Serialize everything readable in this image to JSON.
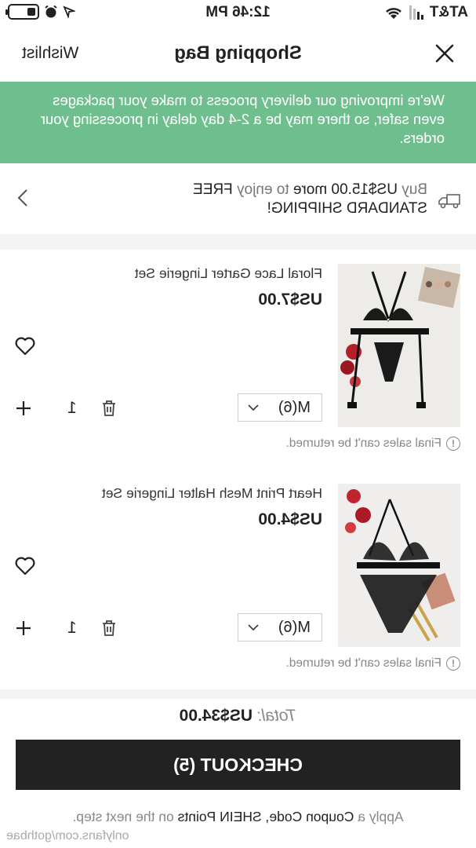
{
  "status_bar": {
    "time": "12:46 PM",
    "carrier": "AT&T"
  },
  "header": {
    "title": "Shopping Bag",
    "wishlist_label": "Wishlist"
  },
  "banner": {
    "text": "We're improving our delivery process to make your packages even safer, so there may be a 2-4 day delay in processing your orders."
  },
  "shipping": {
    "prefix": "Buy",
    "amount": "US$15.00 more",
    "middle": "to enjoy",
    "suffix": "FREE STANDARD SHIPPING!"
  },
  "items": [
    {
      "name": "Floral Lace Garter Lingerie Set",
      "price": "US$7.00",
      "size": "M(6)",
      "quantity": "1",
      "note": "Final sales can't be returned."
    },
    {
      "name": "Heart Print Mesh Halter Lingerie Set",
      "price": "US$4.00",
      "size": "M(6)",
      "quantity": "1",
      "note": "Final sales can't be returned."
    }
  ],
  "summary": {
    "total_label": "Total:",
    "total_value": "US$34.00",
    "checkout_label": "CHECKOUT (5)",
    "apply_prefix": "Apply a",
    "apply_coupon": "Coupon Code",
    "apply_sep": ",",
    "apply_points": "SHEIN Points",
    "apply_suffix": "on the next step."
  },
  "watermark": "onlyfans.com/gothbae",
  "colors": {
    "banner": "#6fbf8e",
    "checkout_bg": "#222222"
  }
}
